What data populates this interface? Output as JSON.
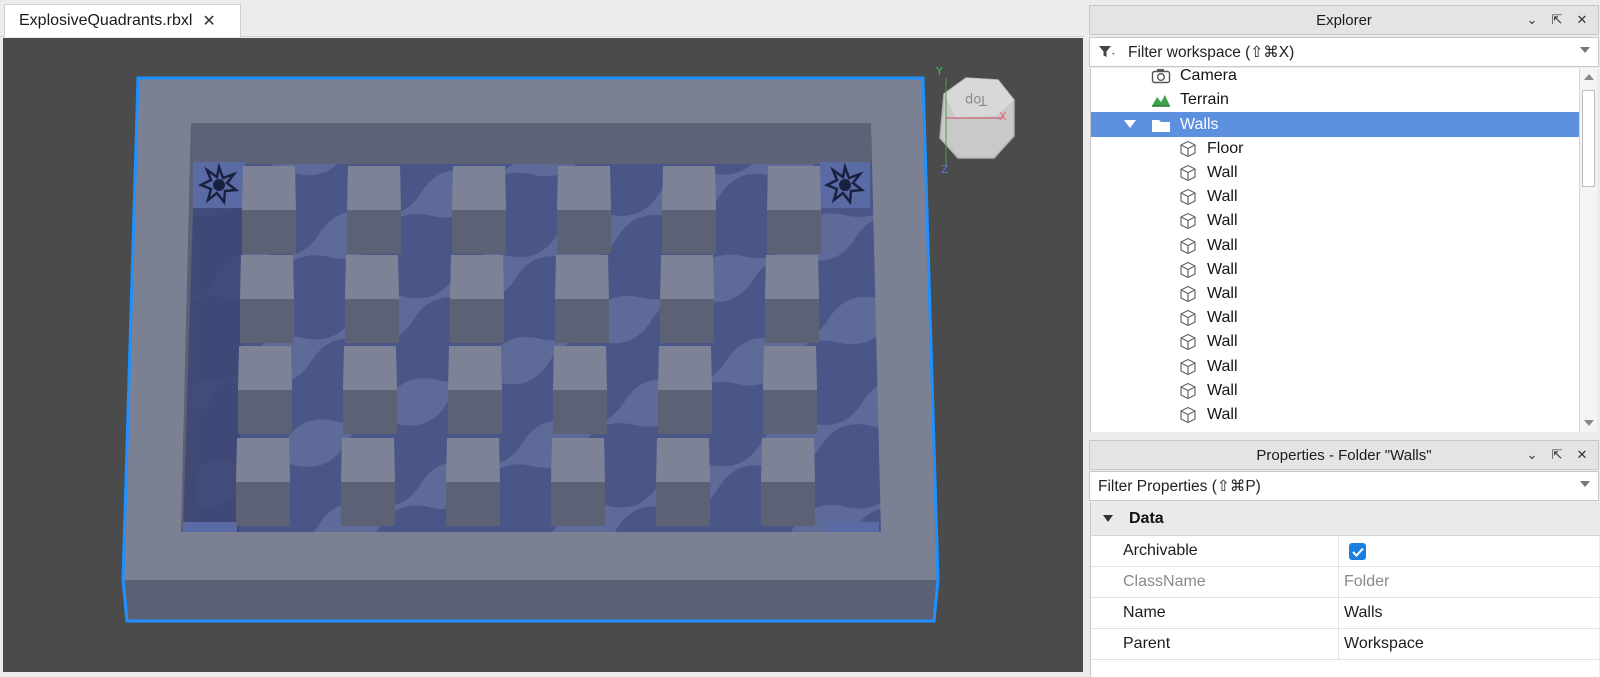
{
  "tab": {
    "title": "ExplosiveQuadrants.rbxl",
    "close_glyph": "✕"
  },
  "viewport": {
    "axis_labels": {
      "y": "Y",
      "x": "X",
      "z": "Z"
    },
    "view_cube_face": "Top",
    "colors": {
      "background": "#4b4b4b",
      "selection_outline": "#1e90ff",
      "wall": "#7a7f93",
      "floor": "#4f5c8a",
      "pillar": "#7b8095"
    }
  },
  "explorer": {
    "title": "Explorer",
    "filter_placeholder": "Filter workspace (⇧⌘X)",
    "items": [
      {
        "label": "Camera",
        "icon": "camera-icon",
        "selected": false
      },
      {
        "label": "Terrain",
        "icon": "terrain-icon",
        "selected": false
      },
      {
        "label": "Walls",
        "icon": "folder-icon",
        "selected": true,
        "expanded": true
      },
      {
        "label": "Floor",
        "icon": "part-icon",
        "selected": false
      },
      {
        "label": "Wall",
        "icon": "part-icon",
        "selected": false
      },
      {
        "label": "Wall",
        "icon": "part-icon",
        "selected": false
      },
      {
        "label": "Wall",
        "icon": "part-icon",
        "selected": false
      },
      {
        "label": "Wall",
        "icon": "part-icon",
        "selected": false
      },
      {
        "label": "Wall",
        "icon": "part-icon",
        "selected": false
      },
      {
        "label": "Wall",
        "icon": "part-icon",
        "selected": false
      },
      {
        "label": "Wall",
        "icon": "part-icon",
        "selected": false
      },
      {
        "label": "Wall",
        "icon": "part-icon",
        "selected": false
      },
      {
        "label": "Wall",
        "icon": "part-icon",
        "selected": false
      },
      {
        "label": "Wall",
        "icon": "part-icon",
        "selected": false
      },
      {
        "label": "Wall",
        "icon": "part-icon",
        "selected": false
      }
    ],
    "selection_color": "#5d8fdf"
  },
  "properties": {
    "title": "Properties - Folder \"Walls\"",
    "filter_placeholder": "Filter Properties (⇧⌘P)",
    "category": "Data",
    "rows": [
      {
        "name": "Archivable",
        "value": "",
        "checked": true,
        "dim": false
      },
      {
        "name": "ClassName",
        "value": "Folder",
        "dim": true
      },
      {
        "name": "Name",
        "value": "Walls",
        "dim": false
      },
      {
        "name": "Parent",
        "value": "Workspace",
        "dim": false
      }
    ],
    "checkbox_color": "#1a7fe0"
  }
}
